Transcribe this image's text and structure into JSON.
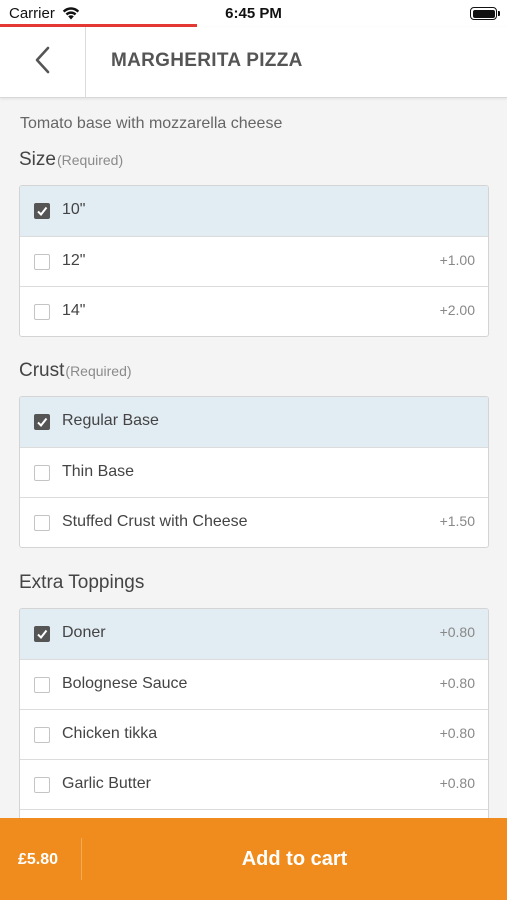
{
  "status_bar": {
    "carrier": "Carrier",
    "time": "6:45 PM",
    "wifi_icon": "wifi-icon",
    "battery_icon": "battery-icon"
  },
  "header": {
    "title": "MARGHERITA PIZZA",
    "back_icon": "chevron-left-icon"
  },
  "description": "Tomato base with mozzarella cheese",
  "sections": [
    {
      "title": "Size",
      "required_label": "(Required)",
      "options": [
        {
          "label": "10\"",
          "price": "",
          "checked": true
        },
        {
          "label": "12\"",
          "price": "+1.00",
          "checked": false
        },
        {
          "label": "14\"",
          "price": "+2.00",
          "checked": false
        }
      ]
    },
    {
      "title": "Crust",
      "required_label": "(Required)",
      "options": [
        {
          "label": "Regular Base",
          "price": "",
          "checked": true
        },
        {
          "label": "Thin Base",
          "price": "",
          "checked": false
        },
        {
          "label": "Stuffed Crust with Cheese",
          "price": "+1.50",
          "checked": false
        }
      ]
    },
    {
      "title": "Extra Toppings",
      "required_label": "",
      "options": [
        {
          "label": "Doner",
          "price": "+0.80",
          "checked": true
        },
        {
          "label": "Bolognese Sauce",
          "price": "+0.80",
          "checked": false
        },
        {
          "label": "Chicken tikka",
          "price": "+0.80",
          "checked": false
        },
        {
          "label": "Garlic Butter",
          "price": "+0.80",
          "checked": false
        }
      ]
    }
  ],
  "footer": {
    "total": "£5.80",
    "add_to_cart_label": "Add to cart"
  },
  "colors": {
    "accent": "#ef8c1d",
    "selected_row": "#e2ecf3",
    "progress": "#e53935"
  }
}
